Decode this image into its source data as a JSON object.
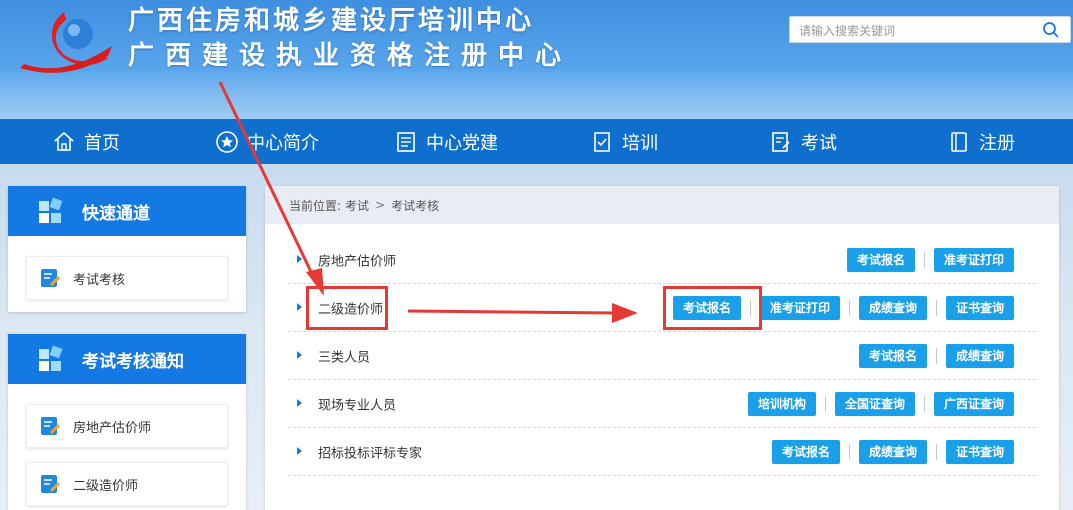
{
  "site": {
    "title_line1": "广西住房和城乡建设厅培训中心",
    "title_line2": "广西建设执业资格注册中心"
  },
  "search": {
    "placeholder": "请输入搜索关键词"
  },
  "nav": [
    {
      "label": "首页",
      "icon": "home-icon"
    },
    {
      "label": "中心简介",
      "icon": "star-circle-icon"
    },
    {
      "label": "中心党建",
      "icon": "document-icon"
    },
    {
      "label": "培训",
      "icon": "checklist-icon"
    },
    {
      "label": "考试",
      "icon": "exam-icon"
    },
    {
      "label": "注册",
      "icon": "notebook-icon"
    }
  ],
  "sidebar": {
    "quick": {
      "title": "快速通道",
      "items": [
        "考试考核"
      ]
    },
    "notice": {
      "title": "考试考核通知",
      "items": [
        "房地产估价师",
        "二级造价师"
      ]
    }
  },
  "breadcrumb": {
    "prefix": "当前位置:",
    "path": [
      "考试",
      "考试考核"
    ],
    "separator": ">"
  },
  "rows": [
    {
      "name": "房地产估价师",
      "buttons": [
        "考试报名",
        "准考证打印"
      ]
    },
    {
      "name": "二级造价师",
      "buttons": [
        "考试报名",
        "准考证打印",
        "成绩查询",
        "证书查询"
      ]
    },
    {
      "name": "三类人员",
      "buttons": [
        "考试报名",
        "成绩查询"
      ]
    },
    {
      "name": "现场专业人员",
      "buttons": [
        "培训机构",
        "全国证查询",
        "广西证查询"
      ]
    },
    {
      "name": "招标投标评标专家",
      "buttons": [
        "考试报名",
        "成绩查询",
        "证书查询"
      ]
    }
  ],
  "colors": {
    "nav_bg": "#0e6fcf",
    "button_bg": "#19a0e8",
    "annotation": "#e53935"
  }
}
